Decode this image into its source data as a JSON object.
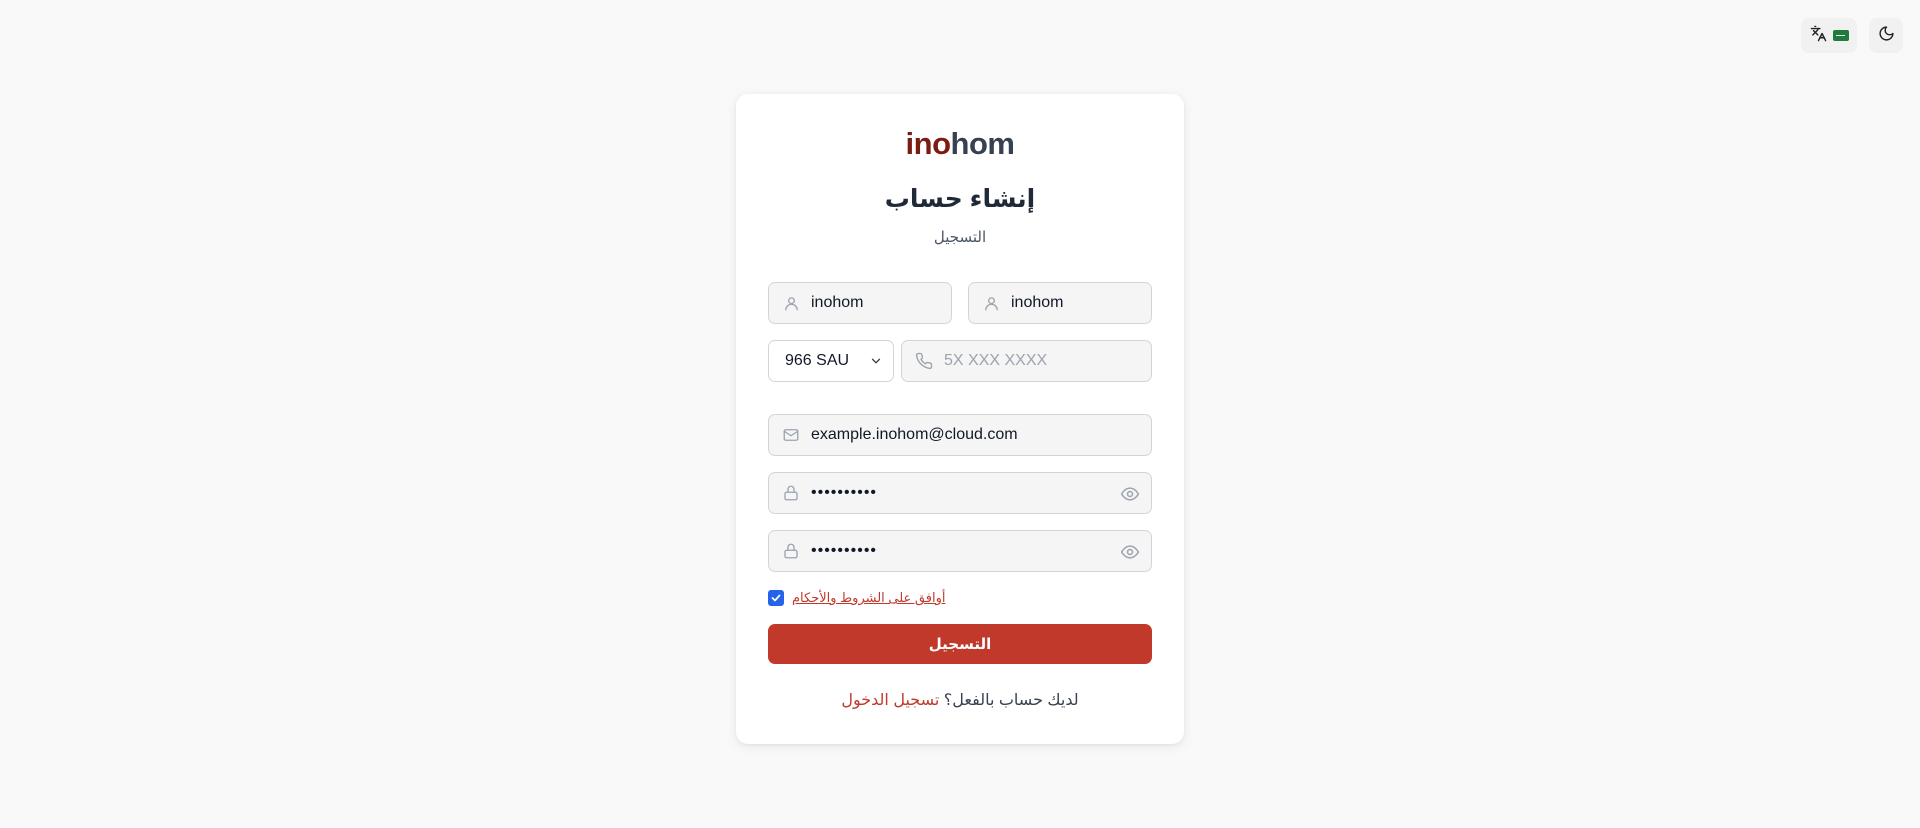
{
  "topbar": {
    "language_icon": "translate-icon",
    "flag_icon": "saudi-flag-icon",
    "theme_icon": "moon-icon"
  },
  "brand": {
    "logo_part1": "ino",
    "logo_part2": "hom",
    "logo_colors": {
      "part1": "#7a1c12",
      "part2": "#374151"
    }
  },
  "header": {
    "title": "إنشاء حساب",
    "subtitle": "التسجيل"
  },
  "form": {
    "first_name": {
      "value": "inohom",
      "icon": "user-icon"
    },
    "last_name": {
      "value": "inohom",
      "icon": "user-icon"
    },
    "country_code": {
      "value": "966 SAU"
    },
    "phone": {
      "placeholder": "5X XXX XXXX",
      "icon": "phone-icon"
    },
    "email": {
      "value": "example.inohom@cloud.com",
      "icon": "mail-icon"
    },
    "password": {
      "value": "••••••••••",
      "icon": "lock-icon"
    },
    "confirm_password": {
      "value": "••••••••••",
      "icon": "lock-icon"
    },
    "terms": {
      "label": "أوافق على الشروط والأحكام",
      "checked": true
    },
    "submit_label": "التسجيل"
  },
  "footer": {
    "question": "لديك حساب بالفعل؟",
    "login_link": "تسجيل الدخول"
  },
  "colors": {
    "accent": "#c0392b",
    "checkbox": "#2563eb",
    "background": "#f9f9f9"
  }
}
